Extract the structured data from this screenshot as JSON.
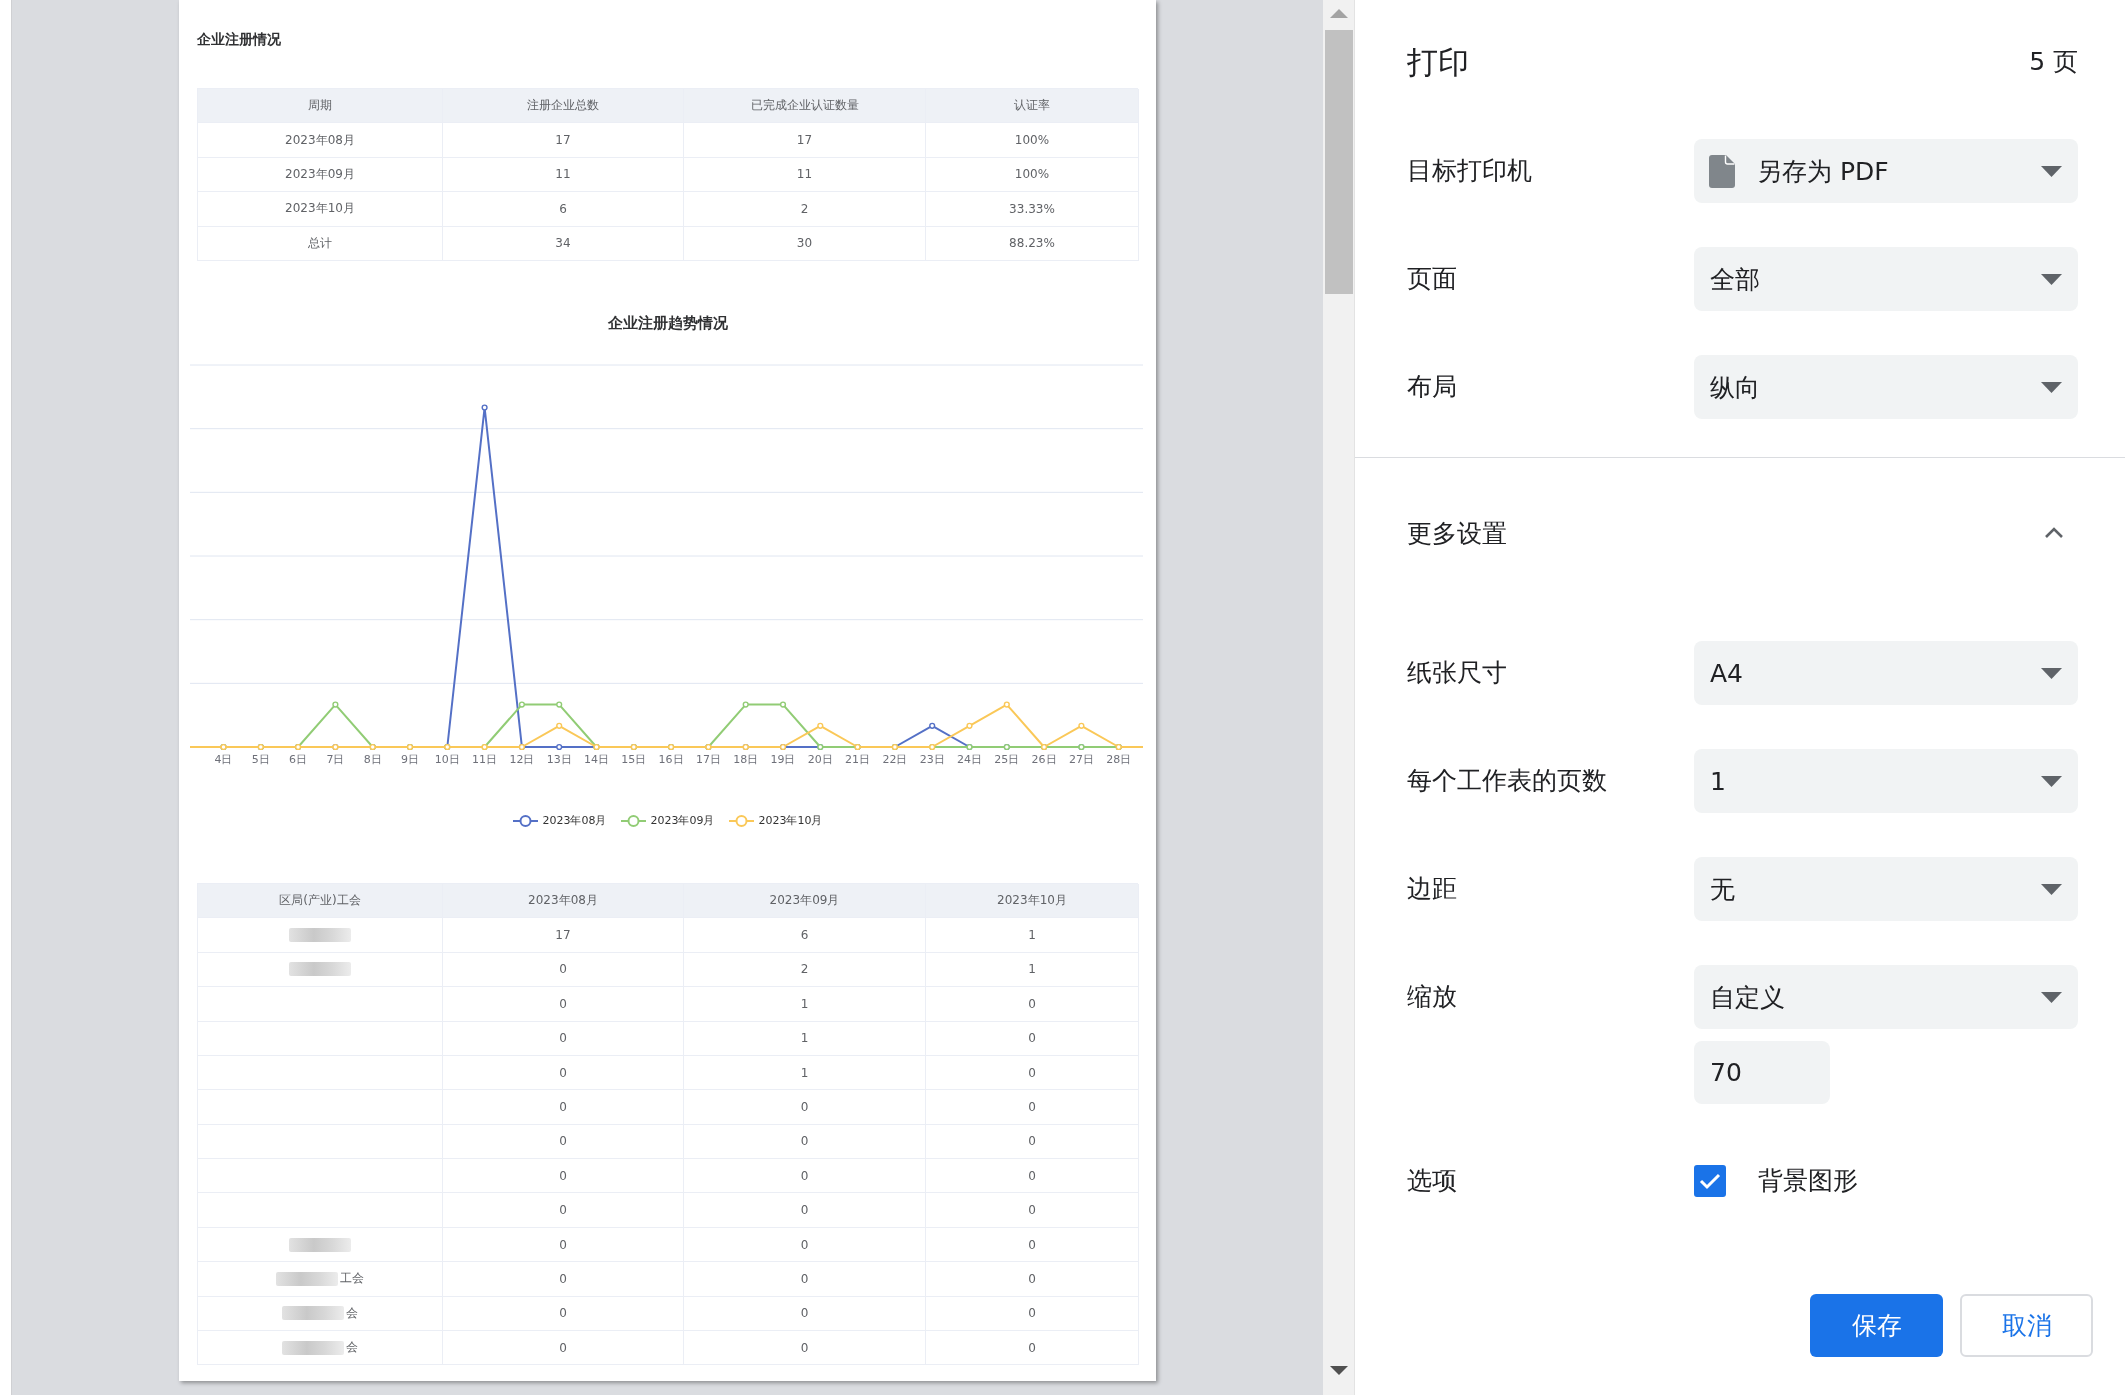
{
  "preview": {
    "report_title": "企业注册情况",
    "summary_table": {
      "columns": [
        "周期",
        "注册企业总数",
        "已完成企业认证数量",
        "认证率"
      ],
      "rows": [
        [
          "2023年08月",
          "17",
          "17",
          "100%"
        ],
        [
          "2023年09月",
          "11",
          "11",
          "100%"
        ],
        [
          "2023年10月",
          "6",
          "2",
          "33.33%"
        ],
        [
          "总计",
          "34",
          "30",
          "88.23%"
        ]
      ]
    },
    "trend_chart": {
      "title": "企业注册趋势情况",
      "x_labels": [
        "4日",
        "5日",
        "6日",
        "7日",
        "8日",
        "9日",
        "10日",
        "11日",
        "12日",
        "13日",
        "14日",
        "15日",
        "16日",
        "17日",
        "18日",
        "19日",
        "20日",
        "21日",
        "22日",
        "23日",
        "24日",
        "25日",
        "26日",
        "27日",
        "28日"
      ],
      "legend": [
        {
          "name": "2023年08月",
          "color": "#5470c6"
        },
        {
          "name": "2023年09月",
          "color": "#91cc75"
        },
        {
          "name": "2023年10月",
          "color": "#fac858"
        }
      ]
    },
    "union_table": {
      "columns": [
        "区局(产业)工会",
        "2023年08月",
        "2023年09月",
        "2023年10月"
      ],
      "rows": [
        {
          "blurred": true,
          "cells": [
            "",
            "17",
            "6",
            "1"
          ]
        },
        {
          "blurred": true,
          "cells": [
            "",
            "0",
            "2",
            "1"
          ]
        },
        {
          "blurred": false,
          "cells": [
            "",
            "0",
            "1",
            "0"
          ]
        },
        {
          "blurred": false,
          "cells": [
            "",
            "0",
            "1",
            "0"
          ]
        },
        {
          "blurred": false,
          "cells": [
            "",
            "0",
            "1",
            "0"
          ]
        },
        {
          "blurred": false,
          "cells": [
            "",
            "0",
            "0",
            "0"
          ]
        },
        {
          "blurred": false,
          "cells": [
            "",
            "0",
            "0",
            "0"
          ]
        },
        {
          "blurred": false,
          "cells": [
            "",
            "0",
            "0",
            "0"
          ]
        },
        {
          "blurred": false,
          "cells": [
            "",
            "0",
            "0",
            "0"
          ]
        },
        {
          "blurred": true,
          "cells": [
            "",
            "0",
            "0",
            "0"
          ]
        },
        {
          "blurred": true,
          "cells": [
            "工会",
            "0",
            "0",
            "0"
          ]
        },
        {
          "blurred": true,
          "cells": [
            "会",
            "0",
            "0",
            "0"
          ]
        },
        {
          "blurred": true,
          "cells": [
            "会",
            "0",
            "0",
            "0"
          ]
        }
      ]
    }
  },
  "print_panel": {
    "title": "打印",
    "page_count": "5 页",
    "settings": [
      {
        "label": "目标打印机",
        "kind": "destination",
        "value": "另存为 PDF"
      },
      {
        "label": "页面",
        "kind": "select",
        "value": "全部"
      },
      {
        "label": "布局",
        "kind": "select",
        "value": "纵向"
      }
    ],
    "more_settings": {
      "label": "更多设置",
      "expanded": true
    },
    "advanced": [
      {
        "label": "纸张尺寸",
        "kind": "select",
        "value": "A4"
      },
      {
        "label": "每个工作表的页数",
        "kind": "select",
        "value": "1"
      },
      {
        "label": "边距",
        "kind": "select",
        "value": "无"
      },
      {
        "label": "缩放",
        "kind": "scale",
        "value": "自定义",
        "custom": "70"
      },
      {
        "label": "选项",
        "kind": "checkbox",
        "option": "背景图形",
        "checked": true
      }
    ],
    "buttons": [
      {
        "label": "保存",
        "kind": "primary"
      },
      {
        "label": "取消",
        "kind": "secondary"
      }
    ]
  }
}
